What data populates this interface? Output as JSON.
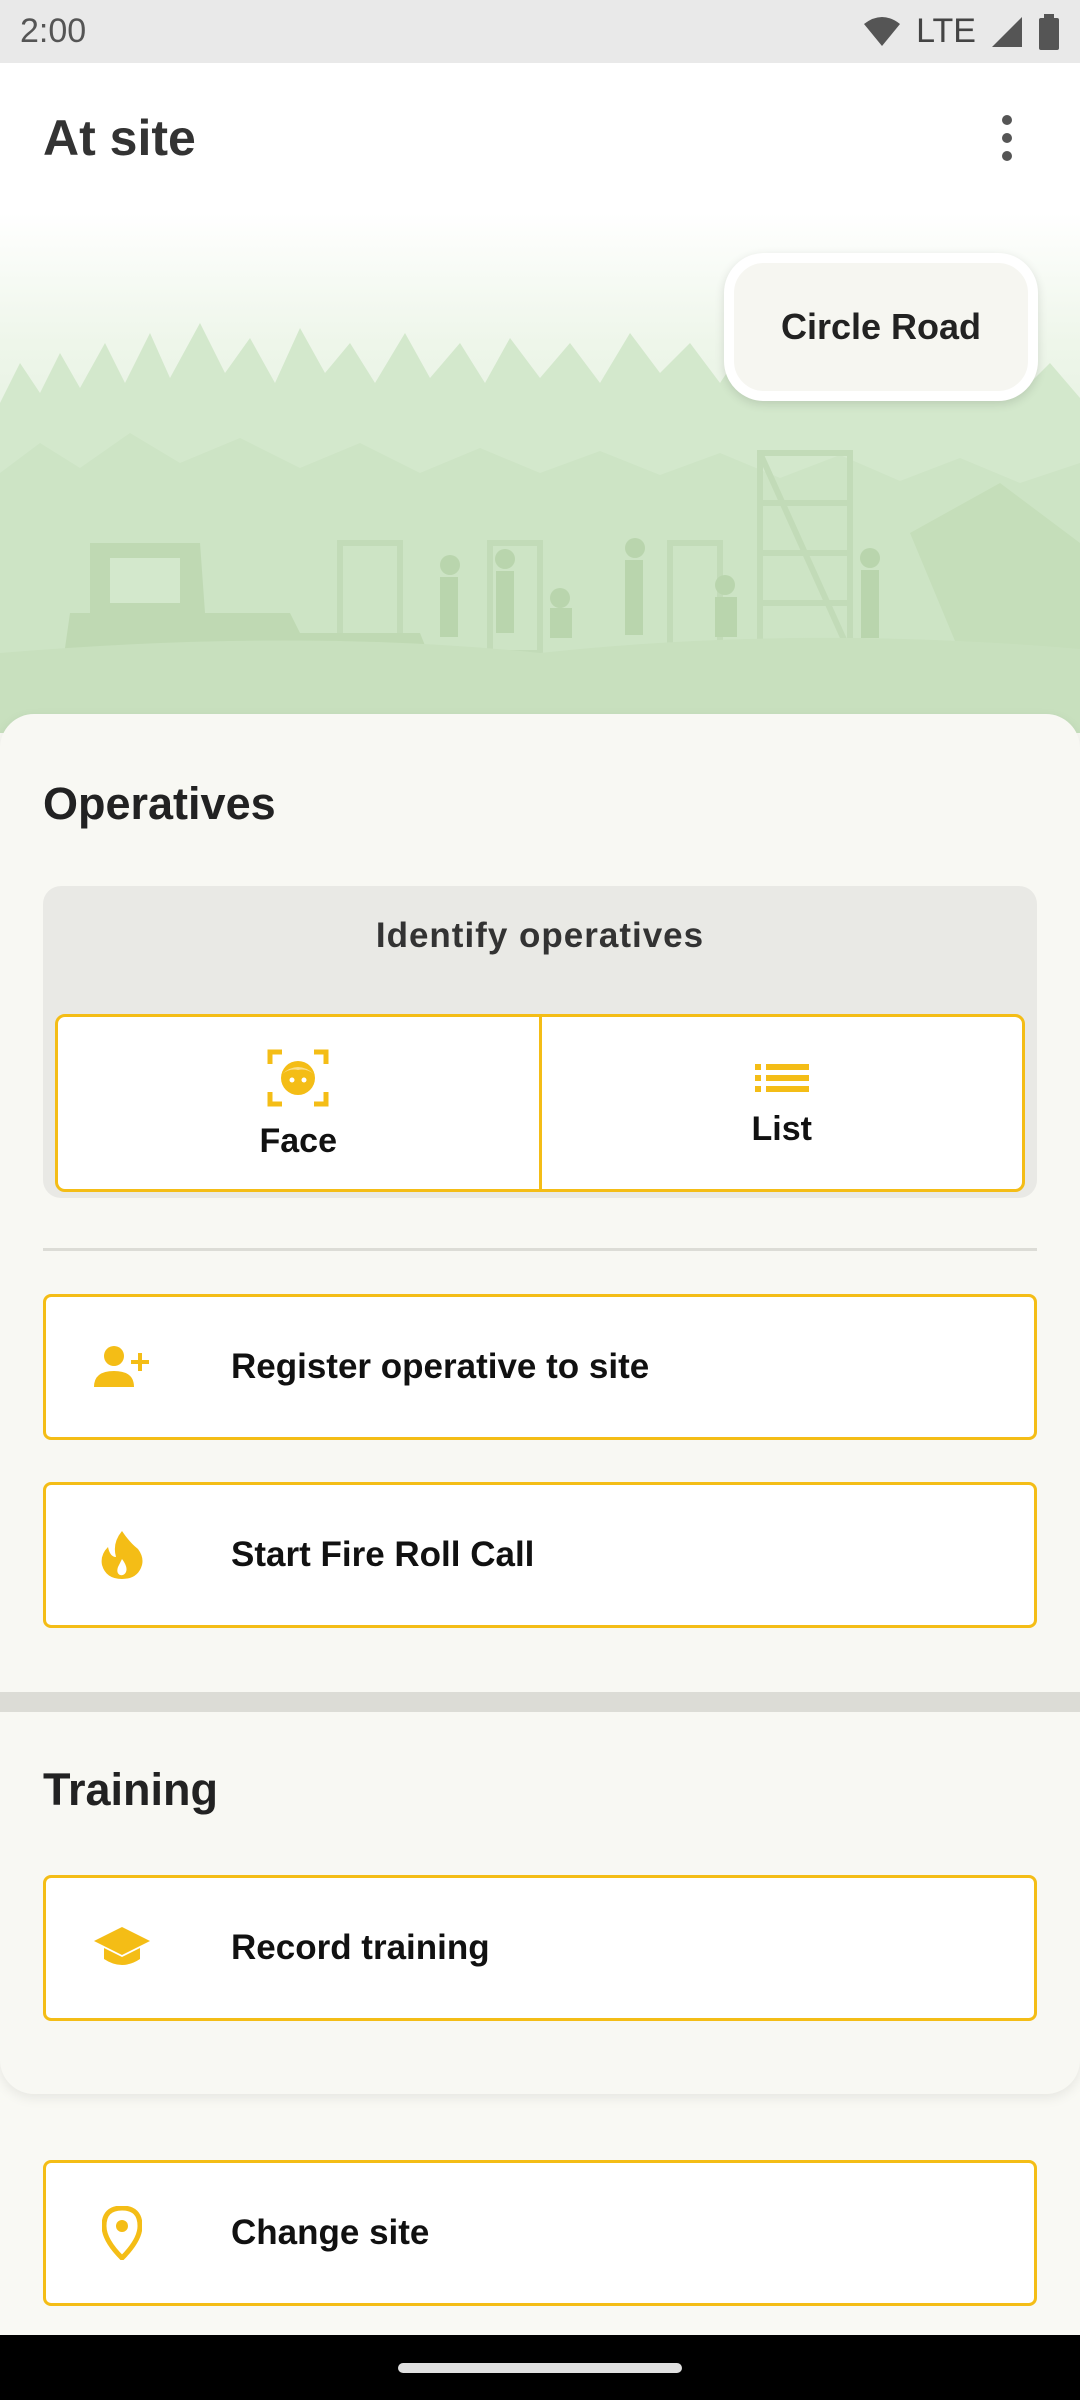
{
  "status_bar": {
    "time": "2:00",
    "network": "LTE"
  },
  "app_bar": {
    "title": "At site",
    "menu_icon": "more-vert-icon"
  },
  "hero": {
    "site_name": "Circle Road"
  },
  "operatives": {
    "heading": "Operatives",
    "identify_title": "Identify operatives",
    "options": [
      {
        "label": "Face",
        "icon": "face-scan-icon"
      },
      {
        "label": "List",
        "icon": "list-icon"
      }
    ],
    "register_label": "Register operative to site",
    "register_icon": "person-add-icon",
    "fire_label": "Start Fire Roll Call",
    "fire_icon": "fire-icon"
  },
  "training": {
    "heading": "Training",
    "record_label": "Record training",
    "record_icon": "graduation-cap-icon"
  },
  "change_site": {
    "label": "Change site",
    "icon": "location-pin-icon"
  },
  "colors": {
    "accent": "#f4bd16",
    "background": "#f8f8f3",
    "hero_green": "#d5e9cf"
  }
}
